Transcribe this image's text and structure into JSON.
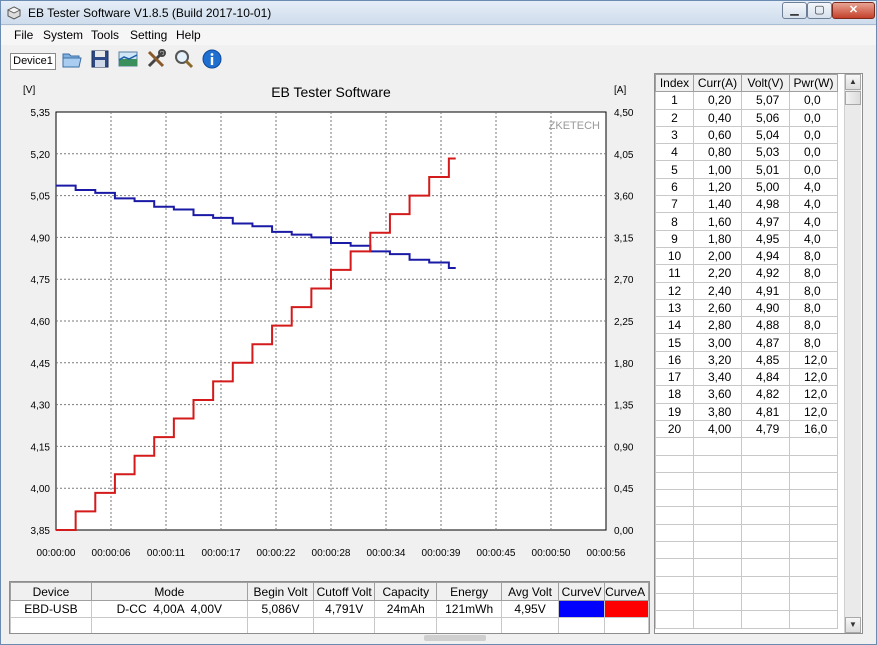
{
  "window": {
    "title": "EB Tester Software V1.8.5 (Build 2017-10-01)"
  },
  "menu": [
    "File",
    "System",
    "Tools",
    "Setting",
    "Help"
  ],
  "toolbar": {
    "device_tab": "Device1"
  },
  "chart_data": {
    "type": "line",
    "title": "EB Tester Software",
    "watermark": "ZKETECH",
    "left_unit": "[V]",
    "right_unit": "[A]",
    "left_ticks": [
      "5,35",
      "5,20",
      "5,05",
      "4,90",
      "4,75",
      "4,60",
      "4,45",
      "4,30",
      "4,15",
      "4,00",
      "3,85"
    ],
    "right_ticks": [
      "4,50",
      "4,05",
      "3,60",
      "3,15",
      "2,70",
      "2,25",
      "1,80",
      "1,35",
      "0,90",
      "0,45",
      "0,00"
    ],
    "x_ticks": [
      "00:00:00",
      "00:00:06",
      "00:00:11",
      "00:00:17",
      "00:00:22",
      "00:00:28",
      "00:00:34",
      "00:00:39",
      "00:00:45",
      "00:00:50",
      "00:00:56"
    ],
    "ylim_left": [
      3.85,
      5.35
    ],
    "ylim_right": [
      0,
      4.5
    ],
    "xlim_s": [
      0,
      56
    ],
    "grid": true,
    "series_colors": {
      "volt": "#1a1aa6",
      "curr": "#d41a1a"
    },
    "steps": {
      "time_s": [
        0,
        2,
        4,
        6,
        8,
        10,
        12,
        14,
        16,
        18,
        20,
        22,
        24,
        26,
        28,
        30,
        32,
        34,
        36,
        38,
        40
      ],
      "volt": [
        5.086,
        5.07,
        5.06,
        5.04,
        5.03,
        5.01,
        5.0,
        4.98,
        4.97,
        4.95,
        4.94,
        4.92,
        4.91,
        4.9,
        4.88,
        4.87,
        4.85,
        4.84,
        4.82,
        4.81,
        4.79
      ],
      "curr": [
        0.0,
        0.2,
        0.4,
        0.6,
        0.8,
        1.0,
        1.2,
        1.4,
        1.6,
        1.8,
        2.0,
        2.2,
        2.4,
        2.6,
        2.8,
        3.0,
        3.2,
        3.4,
        3.6,
        3.8,
        4.0
      ]
    }
  },
  "data_grid": {
    "headers": [
      "Index",
      "Curr(A)",
      "Volt(V)",
      "Pwr(W)"
    ],
    "rows": [
      [
        "1",
        "0,20",
        "5,07",
        "0,0"
      ],
      [
        "2",
        "0,40",
        "5,06",
        "0,0"
      ],
      [
        "3",
        "0,60",
        "5,04",
        "0,0"
      ],
      [
        "4",
        "0,80",
        "5,03",
        "0,0"
      ],
      [
        "5",
        "1,00",
        "5,01",
        "0,0"
      ],
      [
        "6",
        "1,20",
        "5,00",
        "4,0"
      ],
      [
        "7",
        "1,40",
        "4,98",
        "4,0"
      ],
      [
        "8",
        "1,60",
        "4,97",
        "4,0"
      ],
      [
        "9",
        "1,80",
        "4,95",
        "4,0"
      ],
      [
        "10",
        "2,00",
        "4,94",
        "8,0"
      ],
      [
        "11",
        "2,20",
        "4,92",
        "8,0"
      ],
      [
        "12",
        "2,40",
        "4,91",
        "8,0"
      ],
      [
        "13",
        "2,60",
        "4,90",
        "8,0"
      ],
      [
        "14",
        "2,80",
        "4,88",
        "8,0"
      ],
      [
        "15",
        "3,00",
        "4,87",
        "8,0"
      ],
      [
        "16",
        "3,20",
        "4,85",
        "12,0"
      ],
      [
        "17",
        "3,40",
        "4,84",
        "12,0"
      ],
      [
        "18",
        "3,60",
        "4,82",
        "12,0"
      ],
      [
        "19",
        "3,80",
        "4,81",
        "12,0"
      ],
      [
        "20",
        "4,00",
        "4,79",
        "16,0"
      ]
    ],
    "empty_rows": 11
  },
  "summary": {
    "headers": [
      "Device",
      "Mode",
      "Begin Volt",
      "Cutoff Volt",
      "Capacity",
      "Energy",
      "Avg Volt",
      "CurveV",
      "CurveA"
    ],
    "row": [
      "EBD-USB",
      "D-CC  4,00A  4,00V",
      "5,086V",
      "4,791V",
      "24mAh",
      "121mWh",
      "4,95V"
    ],
    "curve_colors": [
      "#0000ff",
      "#ff0000"
    ]
  }
}
